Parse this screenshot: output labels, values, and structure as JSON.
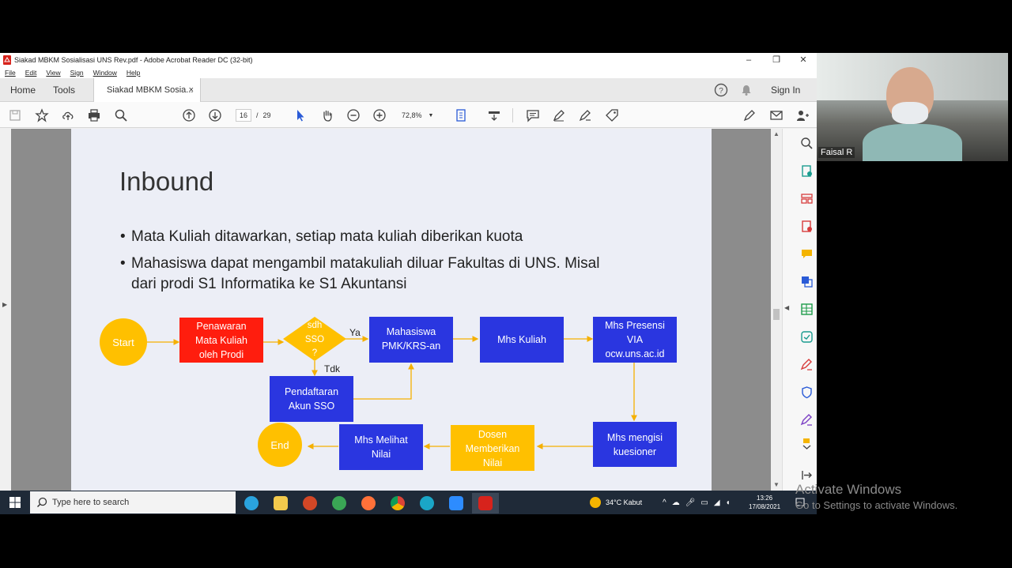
{
  "window": {
    "title": "Siakad MBKM Sosialisasi UNS Rev.pdf - Adobe Acrobat Reader DC (32-bit)",
    "minimize": "–",
    "maximize": "❐",
    "close": "✕"
  },
  "menu": [
    "File",
    "Edit",
    "View",
    "Sign",
    "Window",
    "Help"
  ],
  "tabs": {
    "home": "Home",
    "tools": "Tools",
    "document": "Siakad MBKM Sosia...",
    "document_close": "×",
    "sign_in": "Sign In"
  },
  "toolbar": {
    "page_current": "16",
    "page_separator": "/",
    "page_total": "29",
    "zoom": "72,8%"
  },
  "slide": {
    "title": "Inbound",
    "bullets": [
      "Mata Kuliah ditawarkan, setiap mata kuliah diberikan kuota",
      "Mahasiswa dapat mengambil matakuliah diluar Fakultas di UNS. Misal",
      "dari prodi S1 Informatika ke S1 Akuntansi"
    ],
    "flowchart": {
      "start": "Start",
      "penawaran": [
        "Penawaran",
        "Mata Kuliah",
        "oleh Prodi"
      ],
      "decision": [
        "sdh",
        "SSO",
        "?"
      ],
      "yes": "Ya",
      "no": "Tdk",
      "mahasiswa": [
        "Mahasiswa",
        "PMK/KRS-an"
      ],
      "kuliah": "Mhs Kuliah",
      "presensi": [
        "Mhs  Presensi",
        "VIA",
        "ocw.uns.ac.id"
      ],
      "pendaftaran": [
        "Pendaftaran",
        "Akun SSO"
      ],
      "kuesioner": [
        "Mhs mengisi",
        "kuesioner"
      ],
      "dosen": [
        "Dosen",
        "Memberikan",
        "Nilai"
      ],
      "melihat": [
        "Mhs Melihat",
        "Nilai"
      ],
      "end": "End"
    },
    "colors": {
      "blue": "#2a36e0",
      "red": "#ff1d0e",
      "orange": "#ffc000",
      "arrow": "#f5b000"
    }
  },
  "taskbar": {
    "search_placeholder": "Type here to search",
    "weather": "34°C  Kabut",
    "time": "13:26",
    "date": "17/08/2021"
  },
  "webcam": {
    "name": "Faisal R"
  },
  "watermark": {
    "line1": "Activate Windows",
    "line2": "Go to Settings to activate Windows."
  }
}
